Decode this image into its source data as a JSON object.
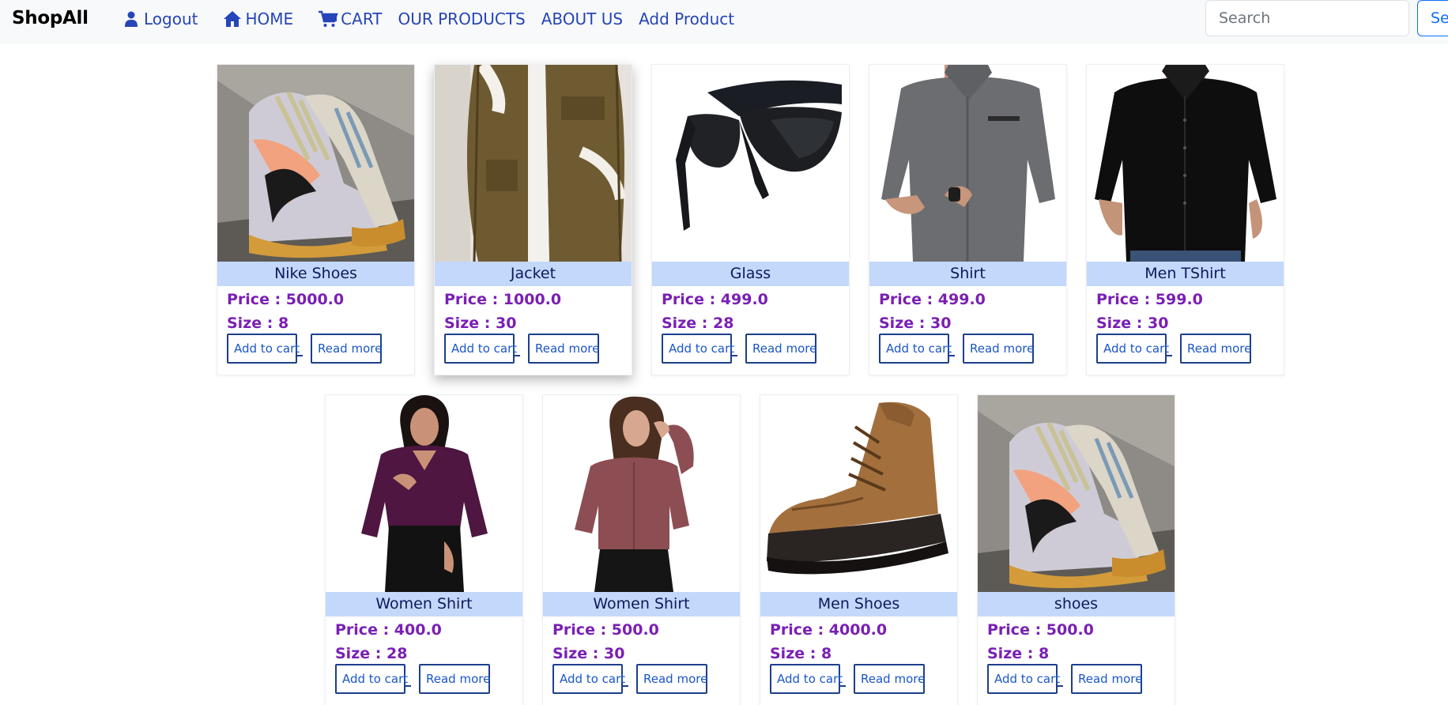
{
  "navbar": {
    "brand": "ShopAll",
    "links": [
      {
        "label": "Logout",
        "icon": "user-icon"
      },
      {
        "label": "HOME",
        "icon": "home-icon"
      },
      {
        "label": "CART",
        "icon": "cart-icon"
      },
      {
        "label": "OUR PRODUCTS"
      },
      {
        "label": "ABOUT US"
      },
      {
        "label": "Add Product"
      }
    ],
    "search_placeholder": "Search",
    "search_button": "Se"
  },
  "products": [
    {
      "title": "Nike Shoes",
      "price": "Price : 5000.0",
      "size": "Size : 8",
      "image": "sneaker-photo"
    },
    {
      "title": "Jacket",
      "price": "Price : 1000.0",
      "size": "Size : 30",
      "image": "jacket-photo"
    },
    {
      "title": "Glass",
      "price": "Price : 499.0",
      "size": "Size : 28",
      "image": "sunglasses-photo"
    },
    {
      "title": "Shirt",
      "price": "Price : 499.0",
      "size": "Size : 30",
      "image": "grey-shirt-photo"
    },
    {
      "title": "Men TShirt",
      "price": "Price : 599.0",
      "size": "Size : 30",
      "image": "black-shirt-photo"
    },
    {
      "title": "Women Shirt",
      "price": "Price : 400.0",
      "size": "Size : 28",
      "image": "purple-blouse-photo"
    },
    {
      "title": "Women Shirt",
      "price": "Price : 500.0",
      "size": "Size : 30",
      "image": "mauve-shirt-photo"
    },
    {
      "title": "Men Shoes",
      "price": "Price : 4000.0",
      "size": "Size : 8",
      "image": "brown-boot-photo"
    },
    {
      "title": "shoes",
      "price": "Price : 500.0",
      "size": "Size : 8",
      "image": "sneaker-photo"
    }
  ],
  "buttons": {
    "add_to_cart": "Add to cart",
    "read_more": "Read more"
  },
  "colors": {
    "link": "#2545b8",
    "title_band": "#c4d8fb",
    "price_text": "#7a1fb5",
    "button_border": "#1d3f8c"
  }
}
